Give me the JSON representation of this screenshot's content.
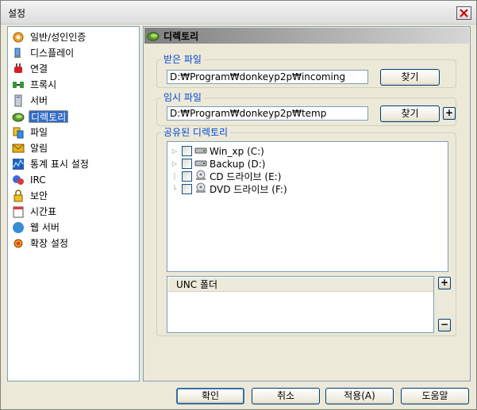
{
  "window": {
    "title": "설정",
    "close_icon": "close-icon"
  },
  "sidebar": {
    "items": [
      {
        "label": "일반/성인인증",
        "icon": "gear-icon"
      },
      {
        "label": "디스플레이",
        "icon": "display-icon"
      },
      {
        "label": "연결",
        "icon": "plug-icon"
      },
      {
        "label": "프록시",
        "icon": "proxy-icon"
      },
      {
        "label": "서버",
        "icon": "server-icon"
      },
      {
        "label": "디렉토리",
        "icon": "folder-icon",
        "selected": true
      },
      {
        "label": "파일",
        "icon": "file-icon"
      },
      {
        "label": "알림",
        "icon": "notify-icon"
      },
      {
        "label": "통계 표시 설정",
        "icon": "stats-icon"
      },
      {
        "label": "IRC",
        "icon": "irc-icon"
      },
      {
        "label": "보안",
        "icon": "lock-icon"
      },
      {
        "label": "시간표",
        "icon": "calendar-icon"
      },
      {
        "label": "웹 서버",
        "icon": "globe-icon"
      },
      {
        "label": "확장 설정",
        "icon": "extension-icon"
      }
    ]
  },
  "panel": {
    "title": "디렉토리",
    "incoming": {
      "legend": "받은 파일",
      "path": "D:₩Program₩donkeyp2p₩incoming",
      "browse_label": "찾기"
    },
    "temp": {
      "legend": "임시 파일",
      "path": "D:₩Program₩donkeyp2p₩temp",
      "browse_label": "찾기",
      "add_label": "+"
    },
    "shared": {
      "legend": "공유된 디렉토리",
      "drives": [
        {
          "label": "Win_xp (C:)",
          "type": "hdd",
          "expandable": true
        },
        {
          "label": "Backup (D:)",
          "type": "hdd",
          "expandable": true
        },
        {
          "label": "CD 드라이브 (E:)",
          "type": "cd",
          "expandable": false
        },
        {
          "label": "DVD 드라이브 (F:)",
          "type": "cd",
          "expandable": false
        }
      ],
      "unc_header": "UNC 폴더",
      "unc_add_label": "+",
      "unc_remove_label": "−"
    }
  },
  "footer": {
    "ok_label": "확인",
    "cancel_label": "취소",
    "apply_label": "적용(A)",
    "help_label": "도움말"
  }
}
